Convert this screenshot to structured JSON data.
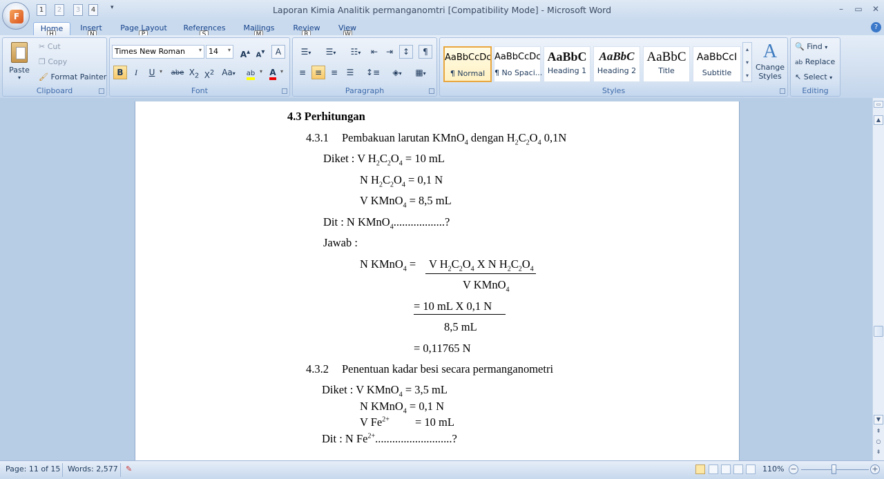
{
  "window": {
    "title": "Laporan Kimia Analitik permanganomtri [Compatibility Mode] - Microsoft Word",
    "minimize": "–",
    "maximize": "▭",
    "close": "✕"
  },
  "office_button": {
    "logo": "F"
  },
  "qat": {
    "keys": [
      "1",
      "2",
      "3",
      "4"
    ]
  },
  "tabs": [
    {
      "label": "Home",
      "key": "H"
    },
    {
      "label": "Insert",
      "key": "N"
    },
    {
      "label": "Page Layout",
      "key": "P"
    },
    {
      "label": "References",
      "key": "S"
    },
    {
      "label": "Mailings",
      "key": "M"
    },
    {
      "label": "Review",
      "key": "R"
    },
    {
      "label": "View",
      "key": "W"
    }
  ],
  "clipboard": {
    "paste": "Paste",
    "cut": "Cut",
    "copy": "Copy",
    "format_painter": "Format Painter",
    "label": "Clipboard"
  },
  "font": {
    "name": "Times New Roman",
    "size": "14",
    "grow": "A",
    "shrink": "A",
    "clear": "A",
    "bold": "B",
    "italic": "I",
    "underline": "U",
    "strike": "abe",
    "subscript": "X",
    "superscript": "X",
    "case": "Aa",
    "highlight": "ab",
    "color": "A",
    "label": "Font"
  },
  "paragraph": {
    "label": "Paragraph",
    "show_marks": "¶"
  },
  "styles": {
    "label": "Styles",
    "items": [
      {
        "sample": "AaBbCcDc",
        "name": "¶ Normal"
      },
      {
        "sample": "AaBbCcDc",
        "name": "¶ No Spaci..."
      },
      {
        "sample": "AaBbC",
        "name": "Heading 1"
      },
      {
        "sample": "AaBbC",
        "name": "Heading 2"
      },
      {
        "sample": "AaBbC",
        "name": "Title"
      },
      {
        "sample": "AaBbCcI",
        "name": "Subtitle"
      }
    ],
    "change_styles": "Change Styles"
  },
  "editing": {
    "label": "Editing",
    "find": "Find",
    "replace": "Replace",
    "select": "Select"
  },
  "doc": {
    "heading": "4.3 Perhitungan",
    "s1_num": "4.3.1",
    "s1_text_a": "Pembakuan larutan KMnO",
    "s1_text_b": " dengan H",
    "s1_text_c": "C",
    "s1_text_d": "O",
    "s1_text_e": " 0,1N",
    "diket1": "Diket : V H",
    "diket1_b": "C",
    "diket1_c": "O",
    "diket1_d": " = 10 mL",
    "n_h2c2o4": "N H",
    "n_h2c2o4_b": "C",
    "n_h2c2o4_c": "O",
    "n_h2c2o4_d": " = 0,1 N",
    "v_kmno4": "V KMnO",
    "v_kmno4_b": " = 8,5 mL",
    "dit1": "Dit : N KMnO",
    "dit1_b": "..................?",
    "jawab": "Jawab :",
    "eq1_lhs": "N KMnO",
    "eq1_lhs_b": " =",
    "eq1_num": "V H",
    "eq1_num_b": "C",
    "eq1_num_c": "O",
    "eq1_num_d": " X N H",
    "eq1_num_e": "C",
    "eq1_num_f": "O",
    "eq1_den": "V KMnO",
    "eq2_num": "= 10 mL X 0,1 N",
    "eq2_den": "8,5 mL",
    "eq3": "= 0,11765 N",
    "s2_num": "4.3.2",
    "s2_text": "Penentuan kadar besi secara permanganometri",
    "diket2": "Diket : V KMnO",
    "diket2_b": " = 3,5 mL",
    "n_kmno4": "N KMnO",
    "n_kmno4_b": " = 0,1 N",
    "v_fe": "V Fe",
    "v_fe_sup": "2+",
    "v_fe_b": "= 10 mL",
    "dit2": "Dit : N Fe",
    "dit2_sup": "2+",
    "dit2_b": "...........................?",
    "sub2": "2",
    "sub4": "4"
  },
  "status": {
    "page": "Page: 11 of 15",
    "words": "Words: 2,577",
    "zoom": "110%"
  }
}
